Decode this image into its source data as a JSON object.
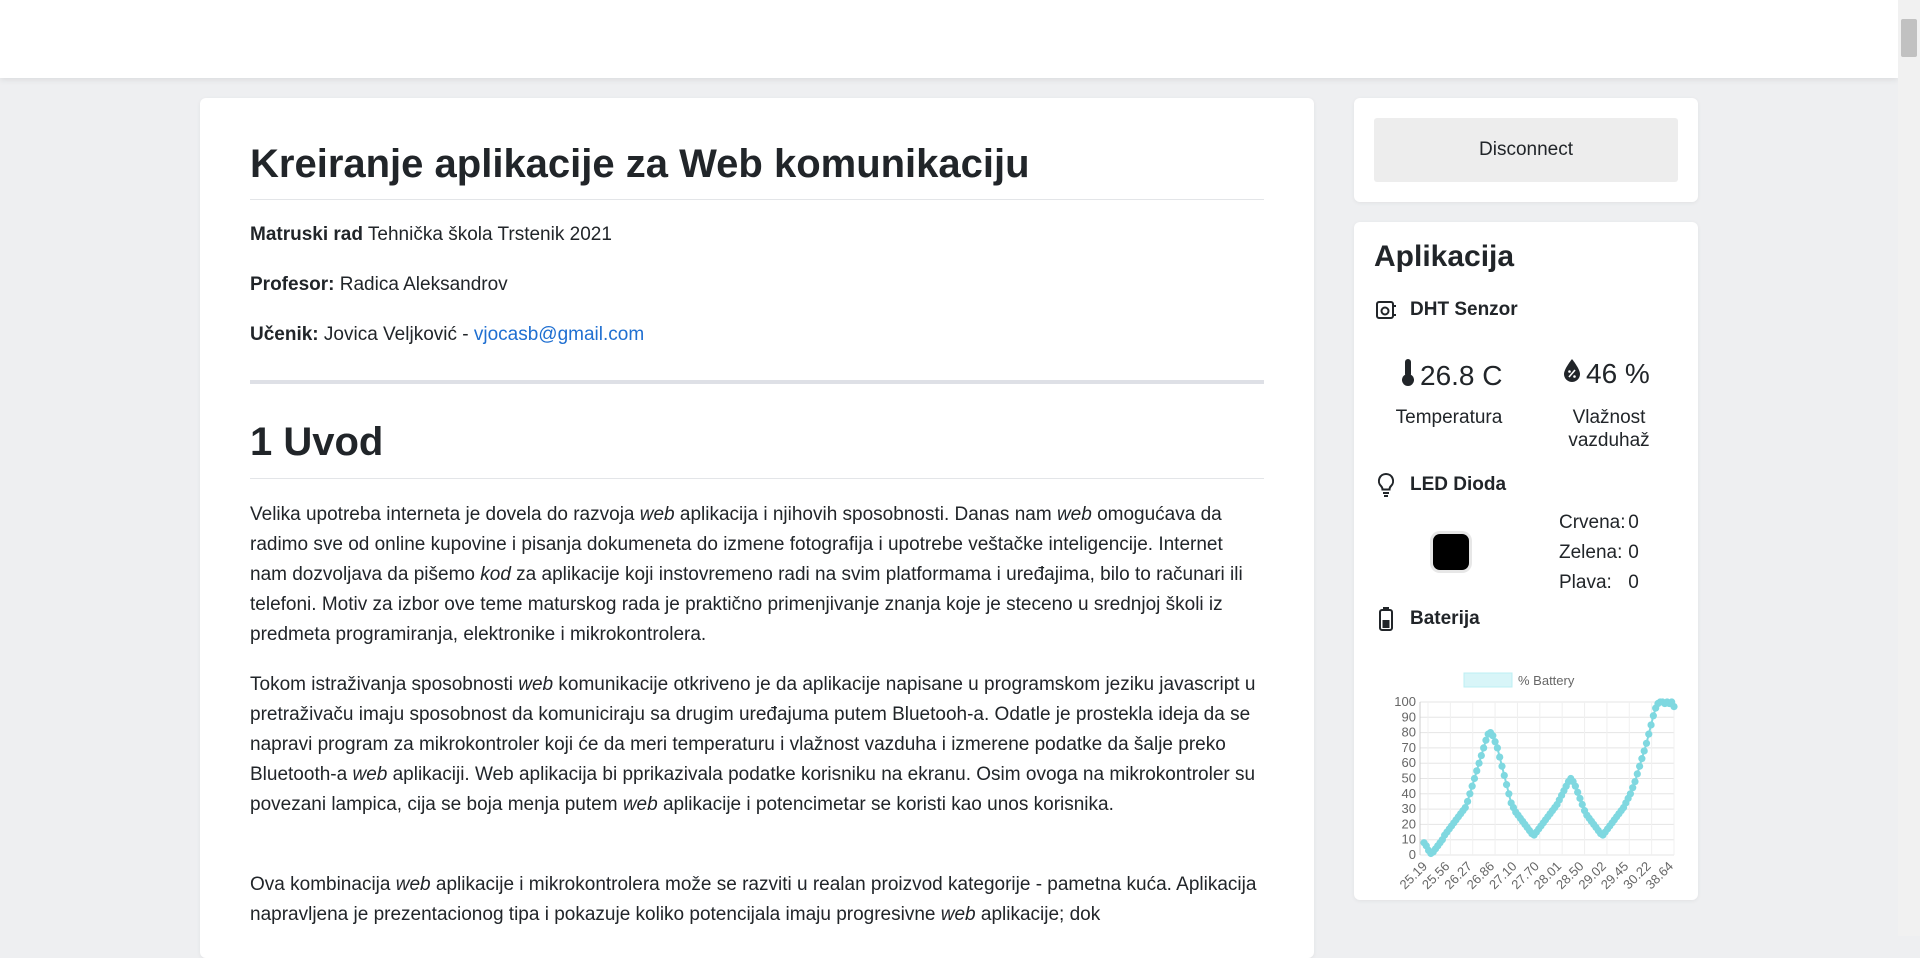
{
  "main": {
    "title": "Kreiranje aplikacije za Web komunikaciju",
    "meta": {
      "rad_label": "Matruski rad",
      "rad_value": "Tehnička škola Trstenik 2021",
      "profesor_label": "Profesor:",
      "profesor_value": "Radica Aleksandrov",
      "ucenik_label": "Učenik:",
      "ucenik_value": "Jovica Veljković - ",
      "email": "vjocasb@gmail.com"
    },
    "section_title": "1 Uvod",
    "p1": {
      "a": "Velika upotreba interneta je dovela do razvoja ",
      "b": "web",
      "c": " aplikacija i njihovih sposobnosti. Danas nam ",
      "d": "web",
      "e": " omogućava da radimo sve od online kupovine i pisanja dokumeneta do izmene fotografija i upotrebe veštačke inteligencije. Internet nam dozvoljava da pišemo ",
      "f": "kod",
      "g": " za aplikacije koji instovremeno radi na svim platformama i uređajima, bilo to računari ili telefoni. Motiv za izbor ove teme maturskog rada je praktično primenjivanje znanja koje je steceno u srednjoj školi iz predmeta programiranja, elektronike i mikrokontrolera."
    },
    "p2": {
      "a": "Tokom istraživanja sposobnosti ",
      "b": "web",
      "c": " komunikacije otkriveno je da aplikacije napisane u programskom jeziku javascript u pretraživaču imaju sposobnost da komuniciraju sa drugim uređajuma putem Bluetooh-a. Odatle je prostekla ideja da se napravi  program za mikrokontroler koji će da meri temperaturu i vlažnost vazduha i izmerene podatke da šalje preko Bluetooth-a ",
      "d": "web",
      "e": " aplikaciji. Web aplikacija bi pprikazivala podatke korisniku na ekranu. Osim ovoga na mikrokontroler su povezani lampica, cija se boja menja putem ",
      "f": "web",
      "g": " aplikacije i potencimetar se koristi kao unos korisnika."
    },
    "p3": {
      "a": "Ova kombinacija ",
      "b": "web",
      "c": " aplikacije i mikrokontrolera može se razviti u realan proizvod kategorije - pametna kuća. Aplikacija napravljena je prezentacionog tipa i pokazuje koliko potencijala imaju progresivne ",
      "d": "web",
      "e": " aplikacije; dok"
    }
  },
  "sidebar": {
    "disconnect_label": "Disconnect",
    "app_title": "Aplikacija",
    "dht": {
      "title": "DHT Senzor",
      "temperature": "26.8 C",
      "temperature_label": "Temperatura",
      "humidity": "46 %",
      "humidity_label_1": "Vlažnost",
      "humidity_label_2": "vazduhaž"
    },
    "led": {
      "title": "LED Dioda",
      "color": "#000000",
      "red_label": "Crvena:",
      "red_value": "0",
      "green_label": "Zelena:",
      "green_value": "0",
      "blue_label": "Plava:",
      "blue_value": "0"
    },
    "battery": {
      "title": "Baterija"
    }
  },
  "chart_data": {
    "type": "line",
    "legend": "% Battery",
    "legend_position": "top",
    "color": "#7fd8e0",
    "ylim": [
      0,
      100
    ],
    "y_ticks": [
      0,
      10,
      20,
      30,
      40,
      50,
      60,
      70,
      80,
      90,
      100
    ],
    "x_tick_labels": [
      "25.19",
      "25.56",
      "26.27",
      "26.86",
      "27.10",
      "27.70",
      "28.01",
      "28.50",
      "29.02",
      "29.45",
      "30.22",
      "38.64"
    ],
    "grid": true,
    "series": [
      {
        "values": [
          8,
          6,
          3,
          1,
          2,
          4,
          6,
          8,
          10,
          13,
          15,
          17,
          19,
          21,
          23,
          25,
          27,
          29,
          31,
          35,
          40,
          45,
          50,
          55,
          60,
          65,
          70,
          75,
          79,
          80,
          78,
          74,
          70,
          64,
          58,
          52,
          46,
          40,
          34,
          31,
          28,
          26,
          24,
          22,
          20,
          18,
          16,
          14,
          13,
          15,
          17,
          19,
          21,
          23,
          25,
          27,
          29,
          31,
          33,
          36,
          39,
          42,
          45,
          48,
          50,
          48,
          45,
          41,
          37,
          33,
          29,
          26,
          24,
          22,
          20,
          18,
          16,
          14,
          13,
          15,
          17,
          19,
          21,
          23,
          25,
          27,
          29,
          31,
          34,
          37,
          40,
          44,
          48,
          53,
          58,
          63,
          68,
          73,
          79,
          85,
          91,
          96,
          99,
          100,
          100,
          99,
          100,
          99,
          100,
          97
        ]
      }
    ]
  }
}
